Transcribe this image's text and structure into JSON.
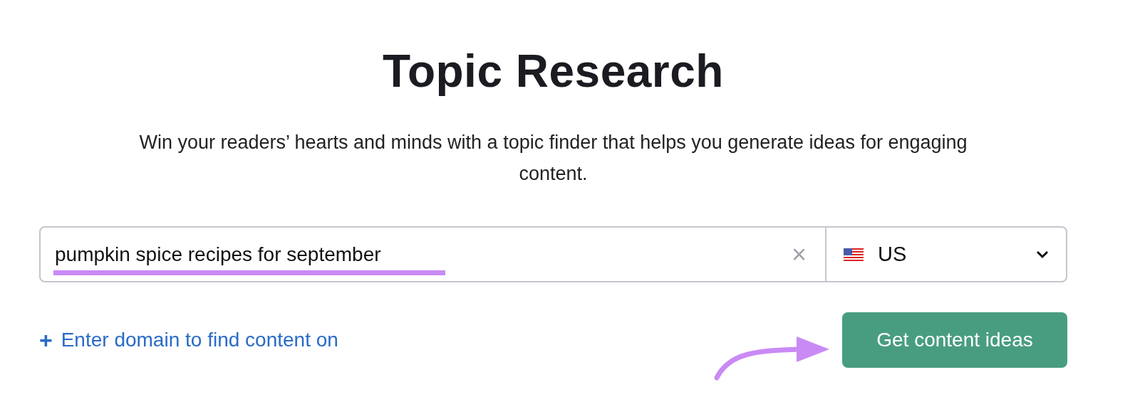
{
  "title": "Topic Research",
  "subtitle": "Win your readers’ hearts and minds with a topic finder that helps you generate ideas for engaging content.",
  "search": {
    "value": "pumpkin spice recipes for september",
    "clear": "×",
    "country": "US"
  },
  "domain_link": {
    "icon": "+",
    "label": "Enter domain to find content on"
  },
  "submit_button": "Get content ideas"
}
